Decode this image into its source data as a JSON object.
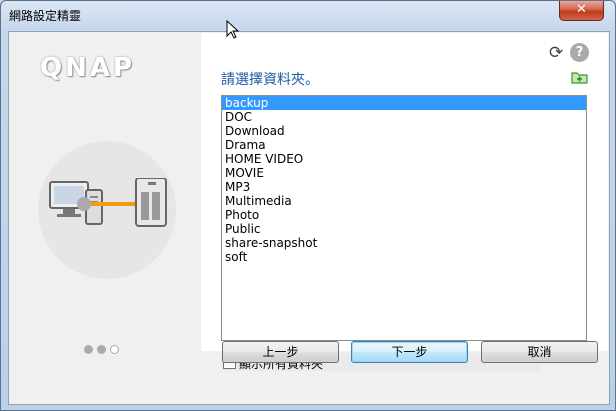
{
  "window": {
    "title": "網路設定精靈",
    "close_label": "✕"
  },
  "branding": {
    "logo_text": "QNAP"
  },
  "wizard": {
    "steps_total": 3,
    "current_step": 1
  },
  "toolbar": {
    "refresh_icon": "refresh-icon",
    "help_icon": "help-icon",
    "help_label": "?",
    "new_folder_icon": "new-folder-icon"
  },
  "folder_picker": {
    "prompt": "請選擇資料夾。",
    "folders": [
      {
        "name": "backup",
        "selected": true
      },
      {
        "name": "DOC",
        "selected": false
      },
      {
        "name": "Download",
        "selected": false
      },
      {
        "name": "Drama",
        "selected": false
      },
      {
        "name": "HOME VIDEO",
        "selected": false
      },
      {
        "name": "MOVIE",
        "selected": false
      },
      {
        "name": "MP3",
        "selected": false
      },
      {
        "name": "Multimedia",
        "selected": false
      },
      {
        "name": "Photo",
        "selected": false
      },
      {
        "name": "Public",
        "selected": false
      },
      {
        "name": "share-snapshot",
        "selected": false
      },
      {
        "name": "soft",
        "selected": false
      }
    ],
    "show_all_label": "顯示所有資料夾",
    "show_all_checked": false
  },
  "buttons": {
    "back": "上一步",
    "next": "下一步",
    "cancel": "取消"
  },
  "colors": {
    "accent": "#3399ff",
    "prompt": "#1c5aa8",
    "connector": "#f39c12"
  }
}
